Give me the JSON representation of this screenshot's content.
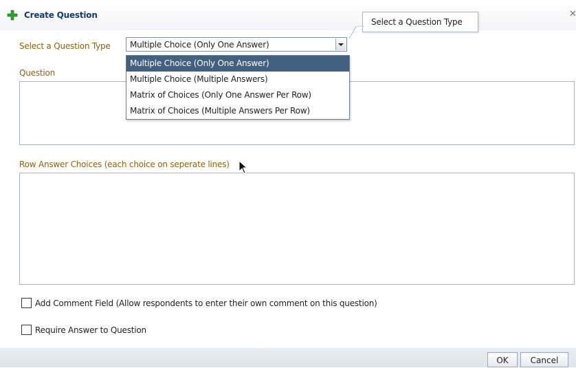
{
  "dialog": {
    "title": "Create Question",
    "title_icon": "plus-icon",
    "close_icon": "close-icon"
  },
  "question_type": {
    "label": "Select a Question Type",
    "selected": "Multiple Choice (Only One Answer)",
    "tooltip": "Select a Question Type",
    "options": [
      "Multiple Choice (Only One Answer)",
      "Multiple Choice (Multiple Answers)",
      "Matrix of Choices (Only One Answer Per Row)",
      "Matrix of Choices (Multiple Answers Per Row)"
    ],
    "highlighted_index": 0
  },
  "question": {
    "label": "Question",
    "value": ""
  },
  "row_choices": {
    "label": "Row Answer Choices (each choice on seperate lines)",
    "value": ""
  },
  "options": {
    "add_comment": {
      "label": "Add Comment Field (Allow respondents to enter their own comment on this question)",
      "checked": false
    },
    "require_answer": {
      "label": "Require Answer to Question",
      "checked": false
    }
  },
  "footer": {
    "ok_label": "OK",
    "cancel_label": "Cancel"
  },
  "colors": {
    "label": "#8a6410",
    "title": "#163a6b",
    "selected_option": "#44607f",
    "plus": "#2f9e2a"
  }
}
